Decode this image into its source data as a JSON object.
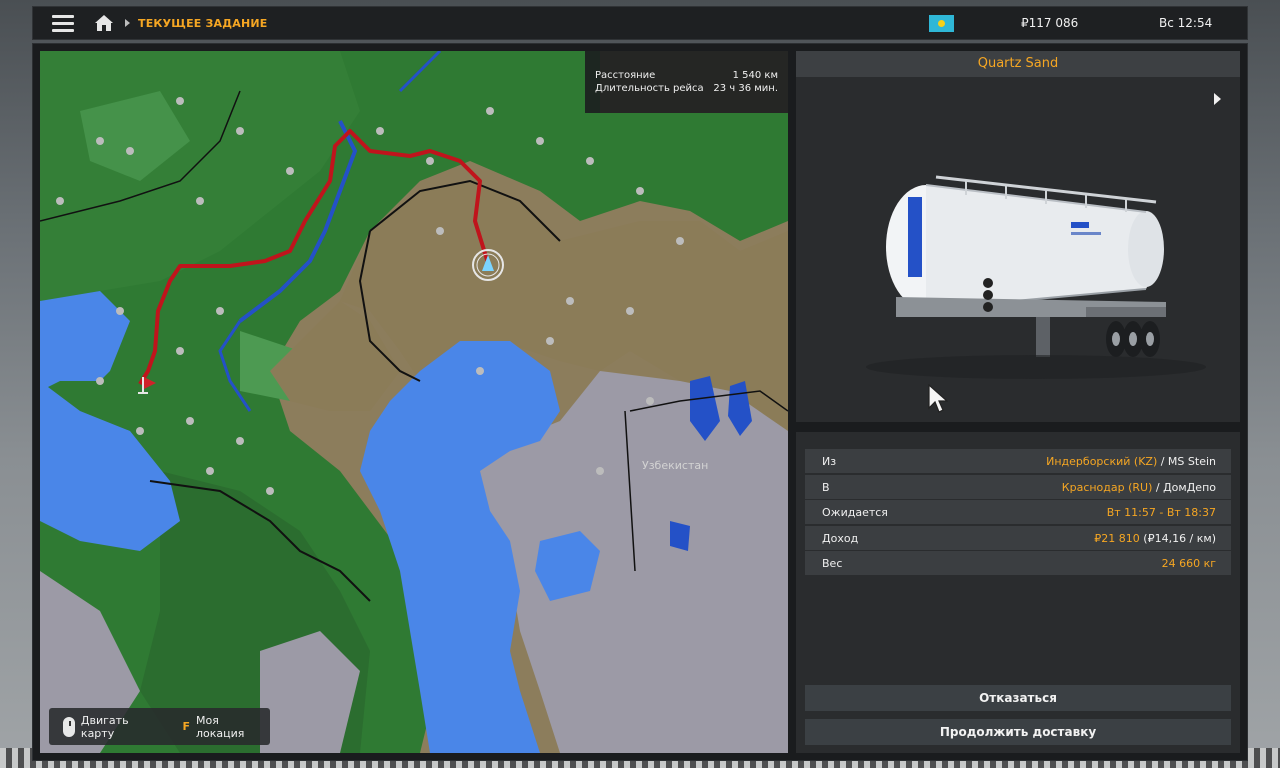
{
  "header": {
    "breadcrumb_title": "ТЕКУЩЕЕ ЗАДАНИЕ",
    "money": "₽117 086",
    "time": "Вс 12:54"
  },
  "map": {
    "stats": {
      "distance_label": "Расстояние",
      "distance_value": "1 540 км",
      "duration_label": "Длительность рейса",
      "duration_value": "23 ч 36 мин."
    },
    "country_label": "Узбекистан",
    "controls": {
      "move_label": "Двигать карту",
      "location_key": "F",
      "location_label": "Моя локация"
    }
  },
  "cargo": {
    "name": "Quartz Sand"
  },
  "details": {
    "from_label": "Из",
    "from_city": "Индерборский (KZ)",
    "from_company": "/ MS Stein",
    "to_label": "В",
    "to_city": "Краснодар (RU)",
    "to_company": "/ ДомДепо",
    "expected_label": "Ожидается",
    "expected_value": "Вт 11:57 - Вт 18:37",
    "income_label": "Доход",
    "income_value": "₽21 810",
    "income_rate": "(₽14,16 / км)",
    "weight_label": "Вес",
    "weight_value": "24 660 кг"
  },
  "actions": {
    "cancel_label": "Отказаться",
    "continue_label": "Продолжить доставку"
  },
  "colors": {
    "accent": "#f5a623",
    "route": "#c0141c",
    "water": "#4a86e8",
    "forest": "#2f7a33"
  },
  "icons": [
    "menu-icon",
    "home-icon",
    "chevron-right-icon",
    "kazakhstan-flag-icon",
    "mouse-icon",
    "player-position-icon",
    "destination-flag-icon",
    "next-arrow-icon",
    "cursor-icon"
  ]
}
